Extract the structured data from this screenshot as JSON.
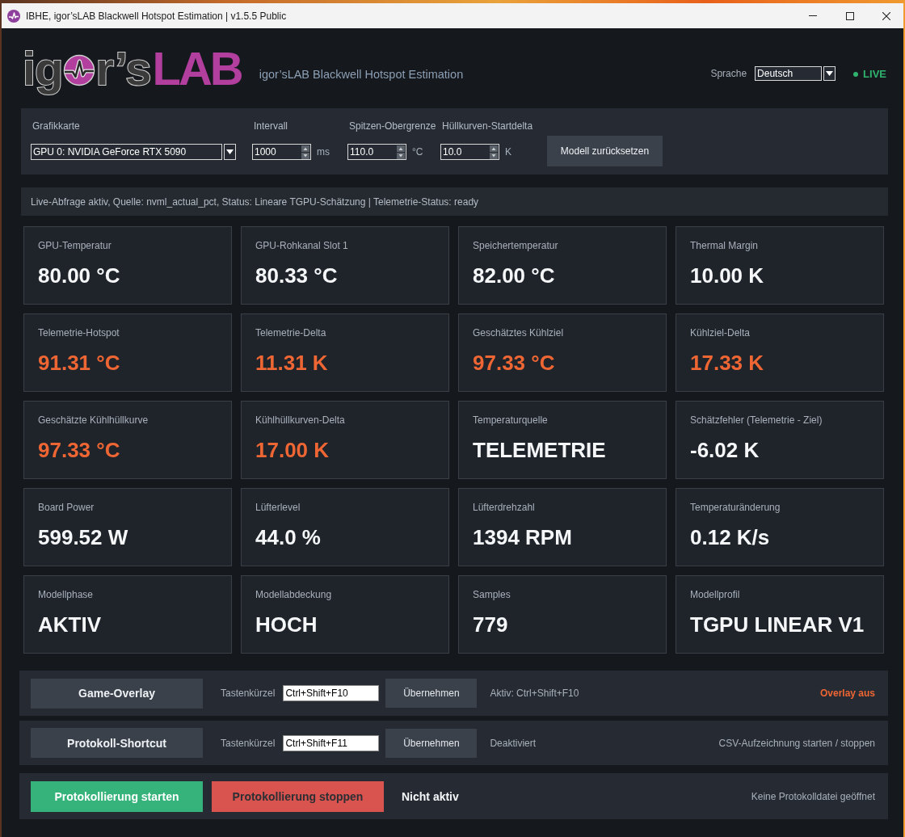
{
  "window": {
    "title": "IBHE, igor’sLAB Blackwell Hotspot Estimation | v1.5.5 Public"
  },
  "header": {
    "logo": {
      "text_1": "ig",
      "text_2": "r’s",
      "text_3": "LAB"
    },
    "subtitle": "igor’sLAB Blackwell Hotspot Estimation",
    "language": {
      "label": "Sprache",
      "value": "Deutsch"
    },
    "live": {
      "label": "LIVE",
      "on": true
    }
  },
  "settings": {
    "fields": [
      {
        "kind": "combo",
        "label": "Grafikkarte",
        "value": "GPU 0: NVIDIA GeForce RTX 5090"
      },
      {
        "kind": "spin",
        "label": "Intervall",
        "value": "1000",
        "unit": "ms"
      },
      {
        "kind": "spin",
        "label": "Spitzen-Obergrenze",
        "value": "110.0",
        "unit": "°C"
      },
      {
        "kind": "spin",
        "label": "Hüllkurven-Startdelta",
        "value": "10.0",
        "unit": "K"
      }
    ],
    "reset_button": "Modell zurücksetzen"
  },
  "status_line": "Live-Abfrage aktiv, Quelle: nvml_actual_pct, Status: Lineare TGPU-Schätzung | Telemetrie-Status: ready",
  "metrics": [
    {
      "label": "GPU-Temperatur",
      "value": "80.00 °C",
      "alert": false
    },
    {
      "label": "GPU-Rohkanal Slot 1",
      "value": "80.33 °C",
      "alert": false
    },
    {
      "label": "Speichertemperatur",
      "value": "82.00 °C",
      "alert": false
    },
    {
      "label": "Thermal Margin",
      "value": "10.00 K",
      "alert": false
    },
    {
      "label": "Telemetrie-Hotspot",
      "value": "91.31 °C",
      "alert": true
    },
    {
      "label": "Telemetrie-Delta",
      "value": "11.31 K",
      "alert": true
    },
    {
      "label": "Geschätztes Kühlziel",
      "value": "97.33 °C",
      "alert": true
    },
    {
      "label": "Kühlziel-Delta",
      "value": "17.33 K",
      "alert": true
    },
    {
      "label": "Geschätzte Kühlhüllkurve",
      "value": "97.33 °C",
      "alert": true
    },
    {
      "label": "Kühlhüllkurven-Delta",
      "value": "17.00 K",
      "alert": true
    },
    {
      "label": "Temperaturquelle",
      "value": "TELEMETRIE",
      "alert": false
    },
    {
      "label": "Schätzfehler (Telemetrie - Ziel)",
      "value": "-6.02 K",
      "alert": false
    },
    {
      "label": "Board Power",
      "value": "599.52 W",
      "alert": false
    },
    {
      "label": "Lüfterlevel",
      "value": "44.0 %",
      "alert": false
    },
    {
      "label": "Lüfterdrehzahl",
      "value": "1394 RPM",
      "alert": false
    },
    {
      "label": "Temperaturänderung",
      "value": "0.12 K/s",
      "alert": false
    },
    {
      "label": "Modellphase",
      "value": "AKTIV",
      "alert": false
    },
    {
      "label": "Modellabdeckung",
      "value": "HOCH",
      "alert": false
    },
    {
      "label": "Samples",
      "value": "779",
      "alert": false
    },
    {
      "label": "Modellprofil",
      "value": "TGPU LINEAR V1",
      "alert": false
    }
  ],
  "shortcuts": [
    {
      "button": "Game-Overlay",
      "shortcut_label": "Tastenkürzel",
      "shortcut": "Ctrl+Shift+F10",
      "apply": "Übernehmen",
      "status": "Aktiv: Ctrl+Shift+F10",
      "note": "Overlay aus",
      "alert": true
    },
    {
      "button": "Protokoll-Shortcut",
      "shortcut_label": "Tastenkürzel",
      "shortcut": "Ctrl+Shift+F11",
      "apply": "Übernehmen",
      "status": "Deaktiviert",
      "note": "CSV-Aufzeichnung starten / stoppen",
      "alert": false
    }
  ],
  "logging": {
    "buttons": [
      {
        "kind": "start",
        "label": "Protokollierung starten",
        "disabled": false
      },
      {
        "kind": "stop",
        "label": "Protokollierung stoppen",
        "disabled": true
      }
    ],
    "state": "Nicht aktiv",
    "file": "Keine Protokolldatei geöffnet"
  }
}
